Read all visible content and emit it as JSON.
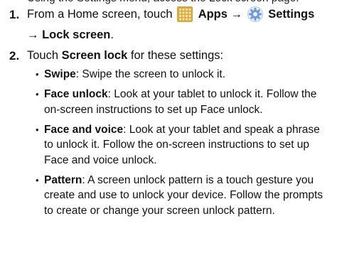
{
  "page_top_fragment": "Using the Settings menu, access the Lock screen page.",
  "steps": [
    {
      "num": "1.",
      "pre": "From a Home screen, touch",
      "apps_label": "Apps →",
      "settings_label": "Settings",
      "lock_label": "→ Lock screen",
      "end": "."
    },
    {
      "num": "2.",
      "pre": "Touch",
      "bold": "Screen lock",
      "post": "for these settings:"
    }
  ],
  "options": [
    {
      "term": "Swipe",
      "desc": ": Swipe the screen to unlock it."
    },
    {
      "term": "Face unlock",
      "desc": ": Look at your tablet to unlock it. Follow the on-screen instructions to set up Face unlock."
    },
    {
      "term": "Face and voice",
      "desc": ": Look at your tablet and speak a phrase to unlock it. Follow the on-screen instructions to set up Face and voice unlock."
    },
    {
      "term": "Pattern",
      "desc": ": A screen unlock pattern is a touch gesture you create and use to unlock your device. Follow the prompts to create or change your screen unlock pattern."
    }
  ],
  "icons": {
    "apps": "apps-grid-icon",
    "settings": "settings-gear-icon"
  },
  "colors": {
    "apps_icon": "#d9a73c",
    "settings_icon": "#6c9ad6"
  }
}
